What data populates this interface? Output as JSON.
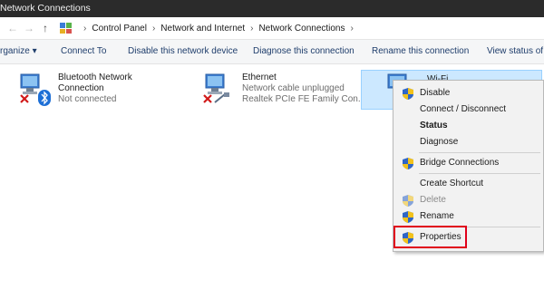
{
  "window": {
    "title": "Network Connections"
  },
  "address": {
    "crumbs": [
      "Control Panel",
      "Network and Internet",
      "Network Connections"
    ]
  },
  "toolbar": {
    "organize": "rganize ▾",
    "connect_to": "Connect To",
    "disable": "Disable this network device",
    "diagnose": "Diagnose this connection",
    "rename": "Rename this connection",
    "view_status": "View status of t"
  },
  "connections": {
    "bluetooth": {
      "name_line1": "Bluetooth Network",
      "name_line2": "Connection",
      "status": "Not connected"
    },
    "ethernet": {
      "name": "Ethernet",
      "status": "Network cable unplugged",
      "adapter": "Realtek PCIe FE Family Con..."
    },
    "wifi": {
      "name": "Wi-Fi"
    }
  },
  "context_menu": {
    "disable": "Disable",
    "connect_disconnect": "Connect / Disconnect",
    "status": "Status",
    "diagnose": "Diagnose",
    "bridge": "Bridge Connections",
    "create_shortcut": "Create Shortcut",
    "delete": "Delete",
    "rename": "Rename",
    "properties": "Properties"
  },
  "colors": {
    "selection": "#cce8ff",
    "highlight_box": "#e0001b",
    "titlebar": "#2b2b2b"
  }
}
